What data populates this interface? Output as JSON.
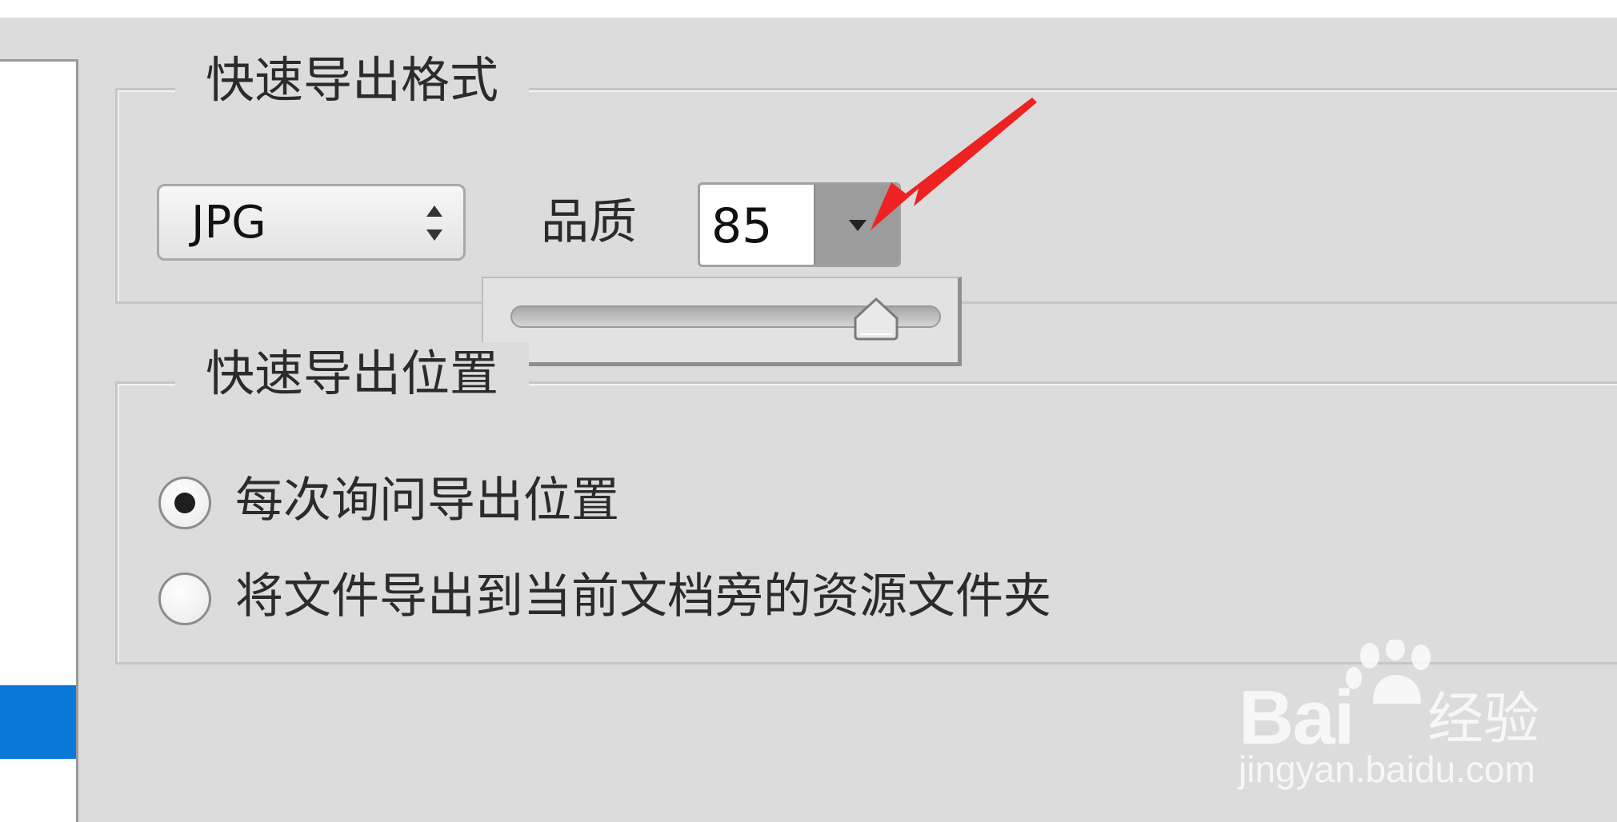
{
  "export_format_group": {
    "title": "快速导出格式",
    "format_value": "JPG",
    "quality_label": "品质",
    "quality_value": "85",
    "quality_slider_fraction": 0.85
  },
  "export_location_group": {
    "title": "快速导出位置",
    "options": [
      {
        "label": "每次询问导出位置",
        "selected": true
      },
      {
        "label": "将文件导出到当前文档旁的资源文件夹",
        "selected": false
      }
    ]
  },
  "watermark": {
    "brand": "Bai",
    "brand_suffix": "经验",
    "url": "jingyan.baidu.com"
  },
  "colors": {
    "panel_bg": "#dcdcdc",
    "selection_blue": "#0a78d7",
    "annotation_red": "#ee2222"
  },
  "icons": {
    "format_select": "updown-arrows-icon",
    "quality_toggle": "caret-down-icon",
    "annotation": "red-arrow-icon",
    "watermark": "paw-icon"
  }
}
